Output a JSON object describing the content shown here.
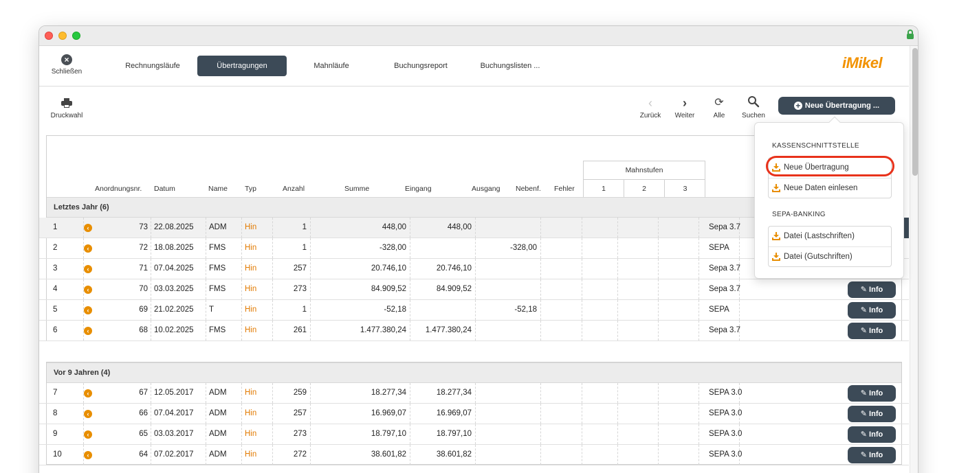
{
  "nav": {
    "close_label": "Schließen",
    "tabs": [
      "Rechnungsläufe",
      "Übertragungen",
      "Mahnläufe",
      "Buchungsreport",
      "Buchungslisten ..."
    ],
    "logo_text": "iMikel"
  },
  "toolbar": {
    "print_label": "Druckwahl",
    "back_label": "Zurück",
    "next_label": "Weiter",
    "all_label": "Alle",
    "search_label": "Suchen",
    "new_button_label": "Neue Übertragung ..."
  },
  "table": {
    "headers": {
      "nr": "Anordnungsnr.",
      "datum": "Datum",
      "name": "Name",
      "typ": "Typ",
      "anzahl": "Anzahl",
      "summe": "Summe",
      "eingang": "Eingang",
      "ausgang": "Ausgang",
      "nebenf": "Nebenf.",
      "fehler": "Fehler",
      "mahnstufen": "Mahnstufen",
      "m1": "1",
      "m2": "2",
      "m3": "3"
    },
    "groups": [
      {
        "title": "Letztes Jahr (6)",
        "rows": [
          {
            "pos": "1",
            "nr": "73",
            "datum": "22.08.2025",
            "name": "ADM",
            "typ": "Hin",
            "anzahl": "1",
            "summe": "448,00",
            "eingang": "448,00",
            "ausgang": "",
            "format": "Sepa 3.7",
            "info": ""
          },
          {
            "pos": "2",
            "nr": "72",
            "datum": "18.08.2025",
            "name": "FMS",
            "typ": "Hin",
            "anzahl": "1",
            "summe": "-328,00",
            "eingang": "",
            "ausgang": "-328,00",
            "format": "SEPA",
            "info": ""
          },
          {
            "pos": "3",
            "nr": "71",
            "datum": "07.04.2025",
            "name": "FMS",
            "typ": "Hin",
            "anzahl": "257",
            "summe": "20.746,10",
            "eingang": "20.746,10",
            "ausgang": "",
            "format": "Sepa 3.7",
            "info": ""
          },
          {
            "pos": "4",
            "nr": "70",
            "datum": "03.03.2025",
            "name": "FMS",
            "typ": "Hin",
            "anzahl": "273",
            "summe": "84.909,52",
            "eingang": "84.909,52",
            "ausgang": "",
            "format": "Sepa 3.7",
            "info": "Info"
          },
          {
            "pos": "5",
            "nr": "69",
            "datum": "21.02.2025",
            "name": "T",
            "typ": "Hin",
            "anzahl": "1",
            "summe": "-52,18",
            "eingang": "",
            "ausgang": "-52,18",
            "format": "SEPA",
            "info": "Info"
          },
          {
            "pos": "6",
            "nr": "68",
            "datum": "10.02.2025",
            "name": "FMS",
            "typ": "Hin",
            "anzahl": "261",
            "summe": "1.477.380,24",
            "eingang": "1.477.380,24",
            "ausgang": "",
            "format": "Sepa 3.7",
            "info": "Info"
          }
        ]
      },
      {
        "title": "Vor 9 Jahren (4)",
        "rows": [
          {
            "pos": "7",
            "nr": "67",
            "datum": "12.05.2017",
            "name": "ADM",
            "typ": "Hin",
            "anzahl": "259",
            "summe": "18.277,34",
            "eingang": "18.277,34",
            "ausgang": "",
            "format": "SEPA 3.0",
            "info": "Info"
          },
          {
            "pos": "8",
            "nr": "66",
            "datum": "07.04.2017",
            "name": "ADM",
            "typ": "Hin",
            "anzahl": "257",
            "summe": "16.969,07",
            "eingang": "16.969,07",
            "ausgang": "",
            "format": "SEPA 3.0",
            "info": "Info"
          },
          {
            "pos": "9",
            "nr": "65",
            "datum": "03.03.2017",
            "name": "ADM",
            "typ": "Hin",
            "anzahl": "273",
            "summe": "18.797,10",
            "eingang": "18.797,10",
            "ausgang": "",
            "format": "SEPA 3.0",
            "info": "Info"
          },
          {
            "pos": "10",
            "nr": "64",
            "datum": "07.02.2017",
            "name": "ADM",
            "typ": "Hin",
            "anzahl": "272",
            "summe": "38.601,82",
            "eingang": "38.601,82",
            "ausgang": "",
            "format": "SEPA 3.0",
            "info": "Info"
          }
        ]
      }
    ]
  },
  "popover": {
    "section1": "KASSENSCHNITTSTELLE",
    "item1": "Neue Übertragung",
    "item2": "Neue Daten einlesen",
    "section2": "SEPA-BANKING",
    "item3": "Datei (Lastschriften)",
    "item4": "Datei (Gutschriften)"
  },
  "colors": {
    "accent_dark": "#3c4a57",
    "orange": "#e88e00",
    "highlight_red": "#e8321b"
  }
}
